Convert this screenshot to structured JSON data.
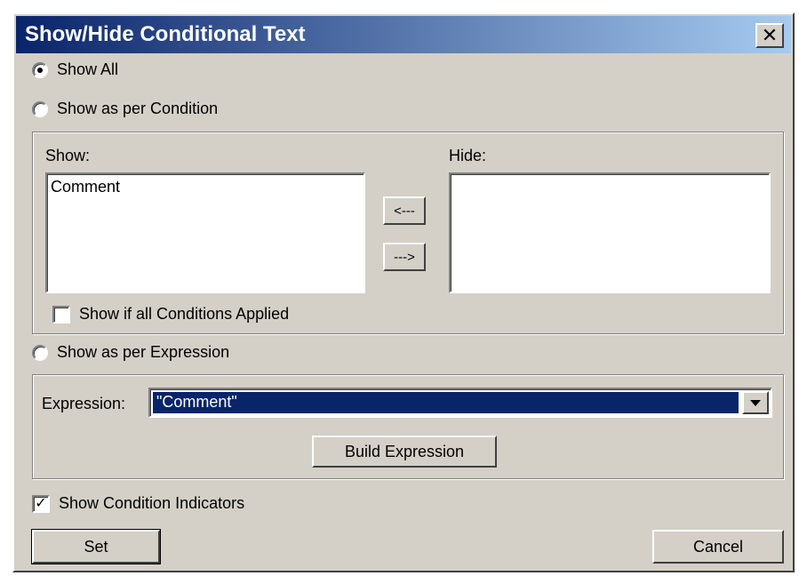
{
  "window": {
    "title": "Show/Hide Conditional Text",
    "close_symbol": "✕"
  },
  "options": {
    "show_all": "Show All",
    "show_as_per_condition": "Show as per Condition",
    "show_as_per_expression": "Show as per Expression",
    "selected": "show_all"
  },
  "condition_group": {
    "show_label": "Show:",
    "hide_label": "Hide:",
    "show_items": [
      "Comment"
    ],
    "hide_items": [],
    "move_left_label": "<---",
    "move_right_label": "--->",
    "show_if_all_applied_label": "Show if all Conditions Applied",
    "show_if_all_applied_checked": false
  },
  "expression_group": {
    "expression_label": "Expression:",
    "expression_value": "\"Comment\"",
    "build_button": "Build Expression"
  },
  "show_condition_indicators": {
    "label": "Show Condition Indicators",
    "checked": true
  },
  "buttons": {
    "set": "Set",
    "cancel": "Cancel"
  },
  "icons": {
    "close": "close-icon",
    "dropdown": "chevron-down-icon"
  }
}
